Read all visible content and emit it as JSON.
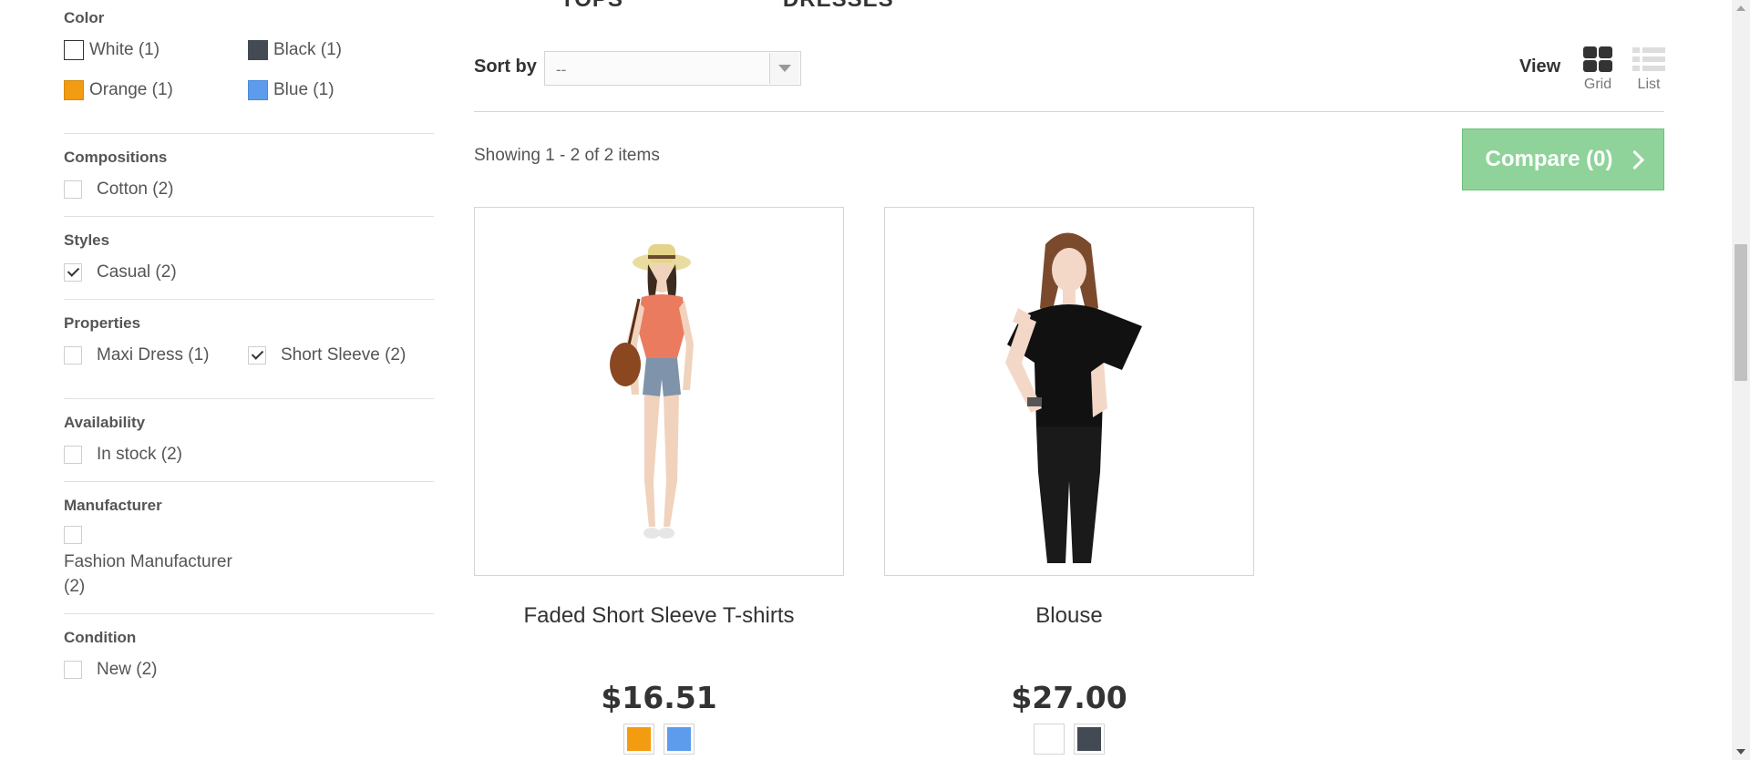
{
  "top_nav": [
    "TOPS",
    "DRESSES"
  ],
  "filters": {
    "color": {
      "title": "Color",
      "options": [
        {
          "label": "White (1)",
          "color": "#ffffff"
        },
        {
          "label": "Black (1)",
          "color": "#434a54"
        },
        {
          "label": "Orange (1)",
          "color": "#f39c11"
        },
        {
          "label": "Blue (1)",
          "color": "#5d9cec"
        }
      ]
    },
    "compositions": {
      "title": "Compositions",
      "options": [
        {
          "label": "Cotton (2)",
          "checked": false
        }
      ]
    },
    "styles": {
      "title": "Styles",
      "options": [
        {
          "label": "Casual (2)",
          "checked": true
        }
      ]
    },
    "properties": {
      "title": "Properties",
      "options": [
        {
          "label": "Maxi Dress (1)",
          "checked": false
        },
        {
          "label": "Short Sleeve (2)",
          "checked": true
        }
      ]
    },
    "availability": {
      "title": "Availability",
      "options": [
        {
          "label": "In stock (2)",
          "checked": false
        }
      ]
    },
    "manufacturer": {
      "title": "Manufacturer",
      "options": [
        {
          "label_line1": "Fashion Manufacturer",
          "label_line2": "(2)",
          "checked": false
        }
      ]
    },
    "condition": {
      "title": "Condition",
      "options": [
        {
          "label": "New (2)",
          "checked": false
        }
      ]
    }
  },
  "sort": {
    "label": "Sort by",
    "value": "--"
  },
  "view": {
    "label": "View",
    "grid": "Grid",
    "list": "List"
  },
  "showing": "Showing 1 - 2 of 2 items",
  "compare": {
    "label": "Compare (0)"
  },
  "products": [
    {
      "name": "Faded Short Sleeve T-shirts",
      "price": "$16.51",
      "colors": [
        "#f39c11",
        "#5d9cec"
      ]
    },
    {
      "name": "Blouse",
      "price": "$27.00",
      "colors": [
        "#ffffff",
        "#434a54"
      ]
    }
  ]
}
